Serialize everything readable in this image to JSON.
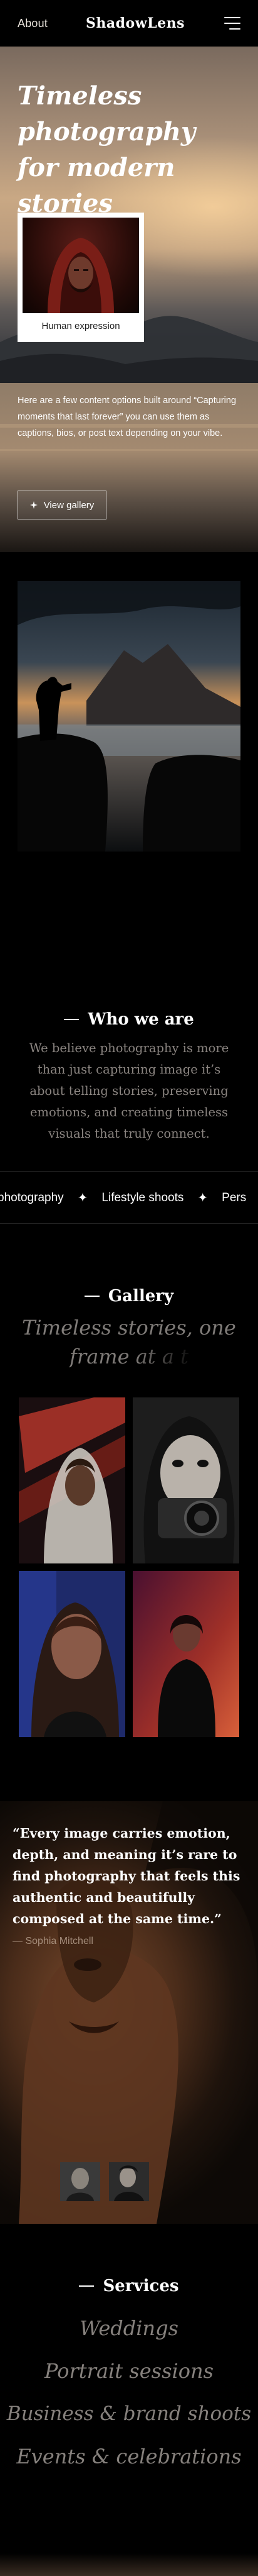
{
  "header": {
    "about_label": "About",
    "brand": "ShadowLens",
    "menu_icon": "hamburger-menu-icon"
  },
  "hero": {
    "title": "Timeless photography for modern stories",
    "card_caption": "Human expression",
    "description": "Here are a few content options built around “Capturing moments that last forever” you can use them as captions, bios, or post text depending on your vibe.",
    "button_label": "View gallery",
    "button_icon": "sparkle-icon"
  },
  "about": {
    "heading": "Who we are",
    "body": "We believe photography is more than just capturing image it’s about telling stories, preserving emotions, and creating timeless visuals that truly connect."
  },
  "marquee": {
    "items": [
      "photography",
      "Lifestyle shoots",
      "Pers"
    ],
    "separator_icon": "four-point-star-icon"
  },
  "gallery": {
    "heading": "Gallery",
    "subtitle_visible": "Timeless stories, one",
    "subtitle_fading": "frame at a t"
  },
  "testimonial": {
    "quote": "“Every image carries emotion, depth, and meaning it’s rare to find photography that feels this authentic and beautifully composed at the same time.”",
    "author": "— Sophia Mitchell"
  },
  "services": {
    "heading": "Services",
    "items": [
      "Weddings",
      "Portrait sessions",
      "Business & brand shoots",
      "Events & celebrations"
    ]
  },
  "colors": {
    "background": "#000000",
    "muted_text": "#86817d",
    "hero_sky": "#c9a884",
    "testimonial_warm": "#7a4a2c"
  }
}
